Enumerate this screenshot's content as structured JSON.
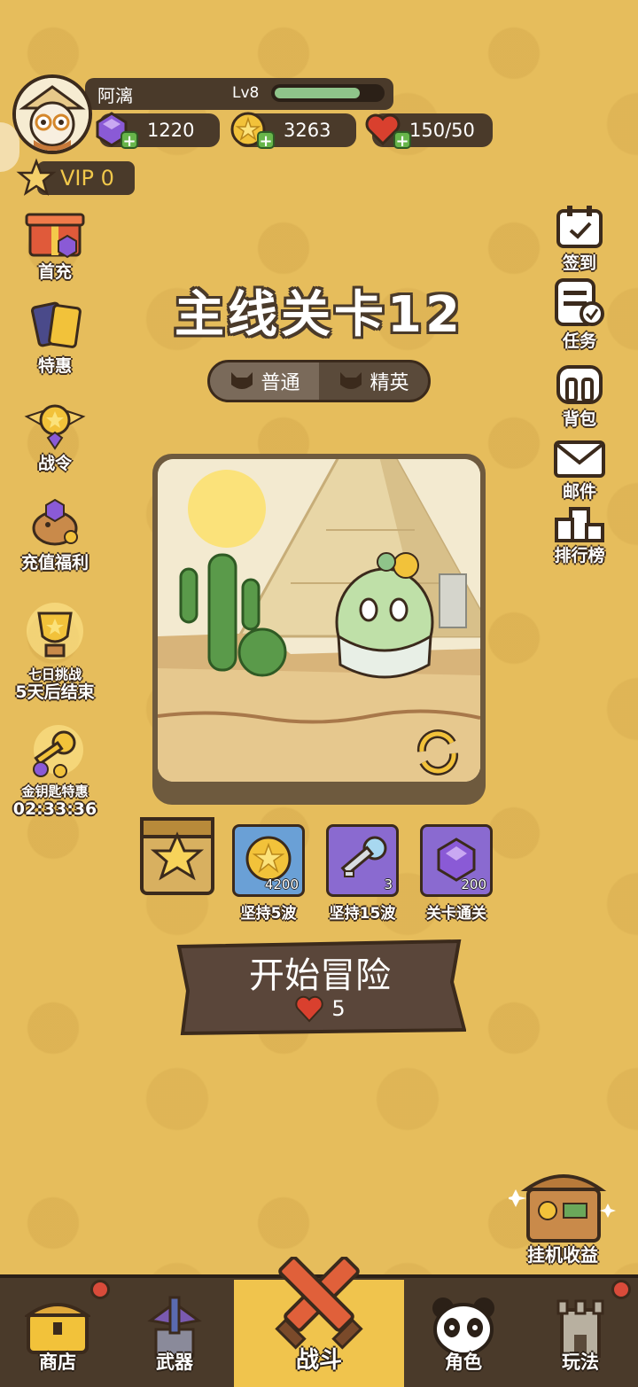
{
  "player": {
    "name": "阿漓",
    "level_label": "Lv8",
    "xp_fraction": 0.8,
    "vip_label": "VIP 0"
  },
  "resources": {
    "gems": "1220",
    "coins": "3263",
    "stamina": "150/50"
  },
  "left_menu": {
    "first_charge": "首充",
    "special_offer": "特惠",
    "battle_pass": "战令",
    "recharge_bonus": "充值福利",
    "seven_day_challenge": "七日挑战",
    "seven_day_timer": "5天后结束",
    "golden_key_offer": "金钥匙特惠",
    "golden_key_timer": "02:33:36"
  },
  "right_menu": {
    "sign_in": "签到",
    "tasks": "任务",
    "backpack": "背包",
    "mail": "邮件",
    "leaderboard": "排行榜"
  },
  "stage": {
    "title": "主线关卡12",
    "mode_normal": "普通",
    "mode_elite": "精英",
    "active_mode": "normal"
  },
  "rewards": [
    {
      "count": "4200",
      "label": "坚持5波",
      "icon": "coin-icon"
    },
    {
      "count": "3",
      "label": "坚持15波",
      "icon": "key-icon"
    },
    {
      "count": "200",
      "label": "关卡通关",
      "icon": "gem-icon"
    }
  ],
  "start": {
    "label": "开始冒险",
    "cost": "5"
  },
  "idle": {
    "label": "挂机收益"
  },
  "nav": {
    "shop": "商店",
    "weapons": "武器",
    "battle": "战斗",
    "character": "角色",
    "gameplay": "玩法"
  },
  "colors": {
    "background": "#e6bd5c",
    "panel": "#4a3a2a",
    "nav_active": "#f0c44d"
  }
}
